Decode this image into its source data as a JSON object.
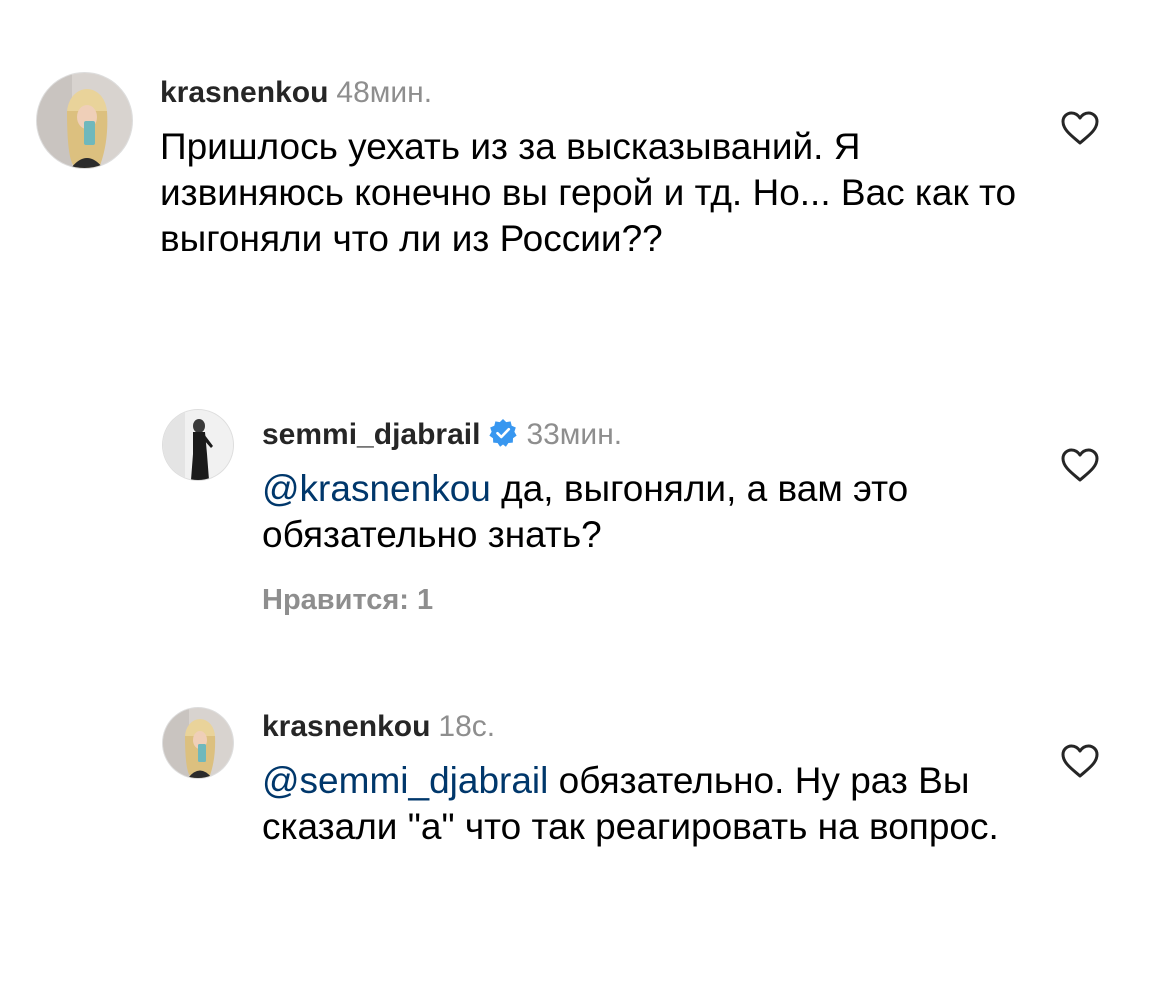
{
  "comments": [
    {
      "username": "krasnenkou",
      "time": "48мин.",
      "mention": "",
      "text": "Пришлось уехать из за высказываний. Я извиняюсь конечно вы герой и тд. Но... Вас как то выгоняли что ли из России??",
      "likes": ""
    },
    {
      "username": "semmi_djabrail",
      "verified": true,
      "time": "33мин.",
      "mention": "@krasnenkou",
      "text": "да, выгоняли, а вам это обязательно знать?",
      "likes": "Нравится: 1"
    },
    {
      "username": "krasnenkou",
      "time": "18с.",
      "mention": "@semmi_djabrail",
      "text": "обязательно. Ну раз Вы сказали \"а\" что так реагировать на вопрос.",
      "likes": ""
    }
  ],
  "colors": {
    "mention": "#00376b",
    "verified": "#3897f0",
    "secondary_text": "#8e8e8e",
    "username": "#262626"
  },
  "icons": {
    "like": "heart-outline-icon",
    "verified": "verified-badge-icon"
  }
}
